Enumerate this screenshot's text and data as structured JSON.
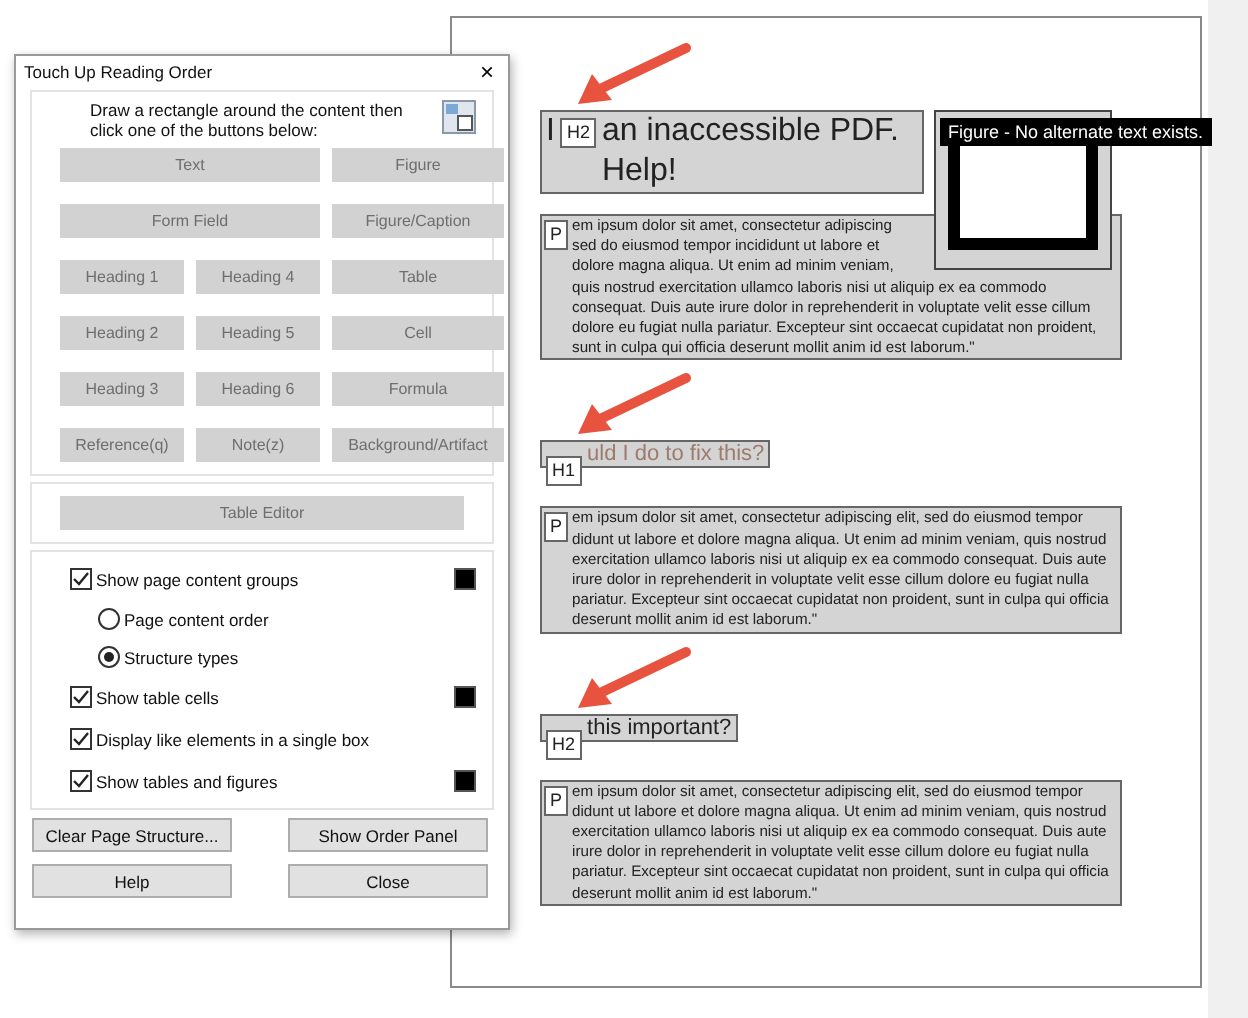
{
  "dialog": {
    "title": "Touch Up Reading Order",
    "close": "×",
    "instruction": "Draw a rectangle around the content then click one of the buttons below:",
    "tag_buttons": [
      {
        "label": "Text",
        "kind": "wide",
        "disabled": true
      },
      {
        "label": "Figure",
        "kind": "single",
        "disabled": true
      },
      {
        "label": "Form Field",
        "kind": "wide",
        "disabled": true
      },
      {
        "label": "Figure/Caption",
        "kind": "single",
        "disabled": true
      },
      {
        "label": "Heading 1",
        "kind": "single",
        "disabled": true
      },
      {
        "label": "Heading 4",
        "kind": "single",
        "disabled": true
      },
      {
        "label": "Table",
        "kind": "single",
        "disabled": true
      },
      {
        "label": "Heading 2",
        "kind": "single",
        "disabled": true
      },
      {
        "label": "Heading 5",
        "kind": "single",
        "disabled": true
      },
      {
        "label": "Cell",
        "kind": "single",
        "disabled": true
      },
      {
        "label": "Heading 3",
        "kind": "single",
        "disabled": true
      },
      {
        "label": "Heading 6",
        "kind": "single",
        "disabled": true
      },
      {
        "label": "Formula",
        "kind": "single",
        "disabled": true
      },
      {
        "label": "Reference(q)",
        "kind": "single",
        "disabled": true
      },
      {
        "label": "Note(z)",
        "kind": "single",
        "disabled": true
      },
      {
        "label": "Background/Artifact",
        "kind": "single",
        "disabled": true
      }
    ],
    "table_editor": {
      "label": "Table Editor",
      "disabled": true
    },
    "options": [
      {
        "kind": "checkbox",
        "label": "Show page content groups",
        "checked": true,
        "color": "#000000"
      },
      {
        "kind": "radio",
        "label": "Page content order",
        "selected": false
      },
      {
        "kind": "radio",
        "label": "Structure types",
        "selected": true
      },
      {
        "kind": "checkbox",
        "label": "Show table cells",
        "checked": true,
        "color": "#000000"
      },
      {
        "kind": "checkbox",
        "label": "Display like elements in a single box",
        "checked": true
      },
      {
        "kind": "checkbox",
        "label": "Show tables and figures",
        "checked": true,
        "color": "#000000"
      }
    ],
    "actions": [
      "Clear Page Structure...",
      "Show Order Panel",
      "Help",
      "Close"
    ]
  },
  "document": {
    "figure": {
      "tooltip": "Figure - No alternate text exists."
    },
    "blocks": [
      {
        "kind": "heading",
        "tag": "H2",
        "lead": "I",
        "text": "an inaccessible PDF. Help!",
        "faded": false
      },
      {
        "kind": "paragraph",
        "tag": "P",
        "text": "em ipsum dolor sit amet, consectetur adipiscing sed do eiusmod tempor incididunt ut labore et dolore magna aliqua. Ut enim ad minim veniam, quis nostrud exercitation ullamco laboris nisi ut aliquip ex ea commodo consequat. Duis aute irure dolor in reprehenderit in voluptate velit esse cillum dolore eu fugiat nulla pariatur. Excepteur sint occaecat cupidatat non proident, sunt in culpa qui officia deserunt mollit anim id est laborum.\""
      },
      {
        "kind": "heading",
        "tag": "H1",
        "text": "uld I do to fix this?",
        "faded": true
      },
      {
        "kind": "paragraph",
        "tag": "P",
        "text": "em ipsum dolor sit amet, consectetur adipiscing elit, sed do eiusmod tempor didunt ut labore et dolore magna aliqua. Ut enim ad minim veniam, quis nostrud exercitation ullamco laboris nisi ut aliquip ex ea commodo consequat. Duis aute irure dolor in reprehenderit in voluptate velit esse cillum dolore eu fugiat nulla pariatur. Excepteur sint occaecat cupidatat non proident, sunt in culpa qui officia deserunt mollit anim id est laborum.\""
      },
      {
        "kind": "heading",
        "tag": "H2",
        "text": "this important?",
        "faded": false
      },
      {
        "kind": "paragraph",
        "tag": "P",
        "text": "em ipsum dolor sit amet, consectetur adipiscing elit, sed do eiusmod tempor didunt ut labore et dolore magna aliqua. Ut enim ad minim veniam, quis nostrud exercitation ullamco laboris nisi ut aliquip ex ea commodo consequat. Duis aute irure dolor in reprehenderit in voluptate velit esse cillum dolore eu fugiat nulla pariatur. Excepteur sint occaecat cupidatat non proident, sunt in culpa qui officia deserunt mollit anim id est laborum.\""
      }
    ]
  }
}
